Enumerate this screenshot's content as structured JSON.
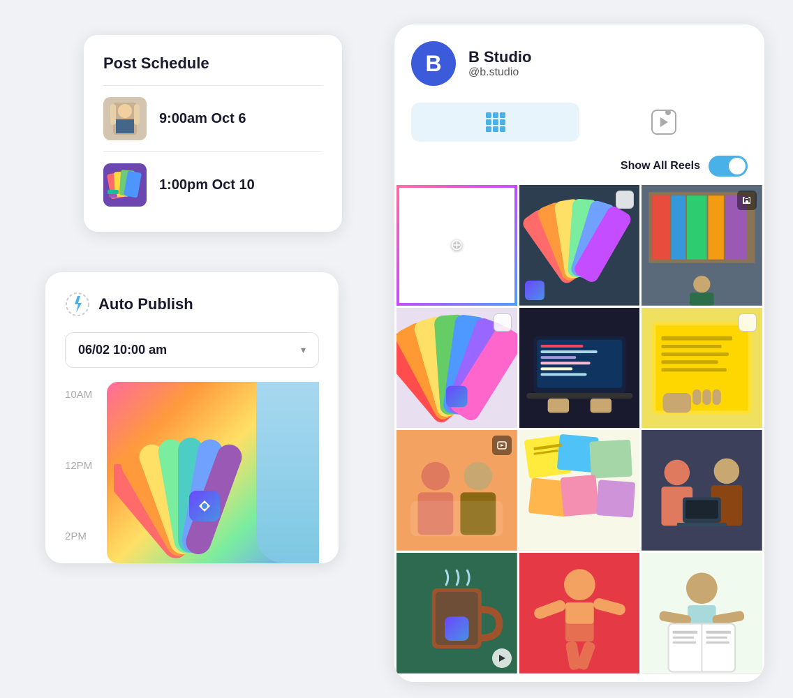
{
  "postSchedule": {
    "title": "Post Schedule",
    "items": [
      {
        "time": "9:00am Oct 6"
      },
      {
        "time": "1:00pm Oct 10"
      }
    ]
  },
  "autoPublish": {
    "title": "Auto Publish",
    "datetime": "06/02  10:00 am",
    "chevron": "▾",
    "timeLabels": [
      "10AM",
      "12PM",
      "2PM"
    ]
  },
  "bstudio": {
    "avatarLetter": "B",
    "name": "B Studio",
    "handle": "@b.studio",
    "tabs": [
      {
        "label": "grid",
        "active": true
      },
      {
        "label": "reels",
        "active": false
      }
    ],
    "showAllReels": "Show All Reels",
    "toggleOn": true
  }
}
